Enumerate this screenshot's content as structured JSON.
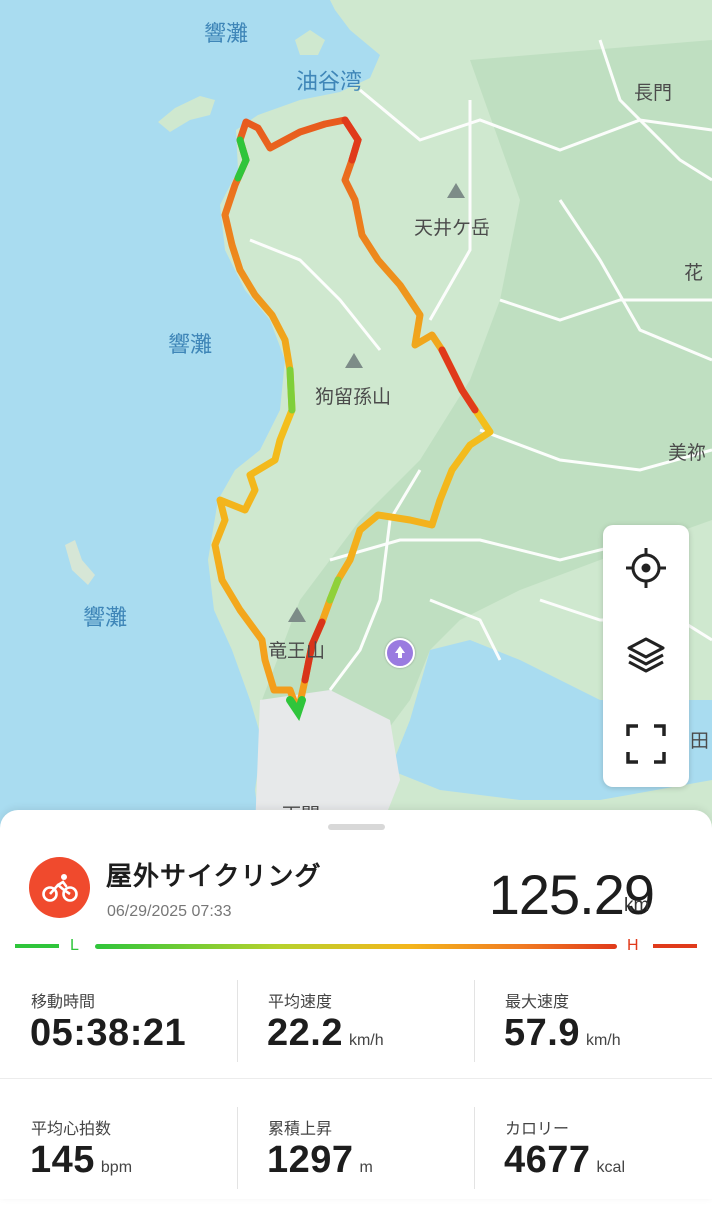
{
  "map": {
    "labels": {
      "sea_top": "響灘",
      "bay": "油谷湾",
      "city_nagato": "長門",
      "peak_amagai": "天井ケ岳",
      "sea_mid": "響灘",
      "peak_kuru": "狗留孫山",
      "sea_low": "響灘",
      "peak_ryuo": "竜王山",
      "edge_hana": "花",
      "edge_mine": "美祢",
      "edge_ta": "田",
      "edge_shimo": "下関"
    },
    "controls": {
      "locate_icon": "crosshair-icon",
      "layers_icon": "layers-icon",
      "fullscreen_icon": "fullscreen-icon"
    },
    "route_colors": {
      "low": "#2fc53b",
      "mid": "#f3d21c",
      "high": "#e03a1b"
    }
  },
  "activity": {
    "type_icon": "bicycle-icon",
    "title": "屋外サイクリング",
    "datetime": "06/29/2025 07:33",
    "distance": "125.29",
    "distance_unit": "km",
    "legend_low": "L",
    "legend_high": "H",
    "accent_color": "#f04a2d"
  },
  "stats": [
    {
      "label": "移動時間",
      "value": "05:38:21",
      "unit": ""
    },
    {
      "label": "平均速度",
      "value": "22.2",
      "unit": "km/h"
    },
    {
      "label": "最大速度",
      "value": "57.9",
      "unit": "km/h"
    },
    {
      "label": "平均心拍数",
      "value": "145",
      "unit": "bpm"
    },
    {
      "label": "累積上昇",
      "value": "1297",
      "unit": "m"
    },
    {
      "label": "カロリー",
      "value": "4677",
      "unit": "kcal"
    }
  ]
}
